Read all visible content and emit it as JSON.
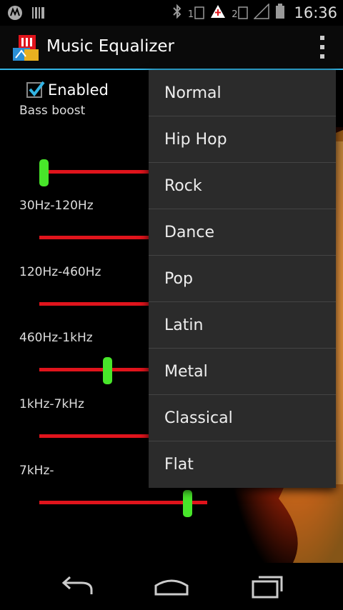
{
  "status_bar": {
    "icons_left": [
      "motorola-icon",
      "barcode-icon"
    ],
    "icons_right": [
      "bluetooth-icon",
      "sim1-icon",
      "notification-icon",
      "sim2-icon",
      "signal-icon",
      "battery-icon"
    ],
    "sim1": "1",
    "sim2": "2",
    "time": "16:36"
  },
  "action_bar": {
    "title": "Music Equalizer"
  },
  "equalizer": {
    "enabled_label": "Enabled",
    "enabled": true,
    "bass_boost_label": "Bass boost",
    "bands": [
      {
        "label": "30Hz-120Hz",
        "level": 0.0
      },
      {
        "label": "120Hz-460Hz",
        "level": 0.0
      },
      {
        "label": "460Hz-1kHz",
        "level": 0.41
      },
      {
        "label": "1kHz-7kHz",
        "level": 0.0
      },
      {
        "label": "7kHz-",
        "level": 0.88
      }
    ],
    "bass_boost_level": 0.03
  },
  "preset_menu": {
    "items": [
      "Normal",
      "Hip Hop",
      "Rock",
      "Dance",
      "Pop",
      "Latin",
      "Metal",
      "Classical",
      "Flat"
    ]
  },
  "colors": {
    "accent": "#33b5e5",
    "track": "#e0141c",
    "thumb": "#48e62a",
    "menu_bg": "#2b2b2b"
  }
}
